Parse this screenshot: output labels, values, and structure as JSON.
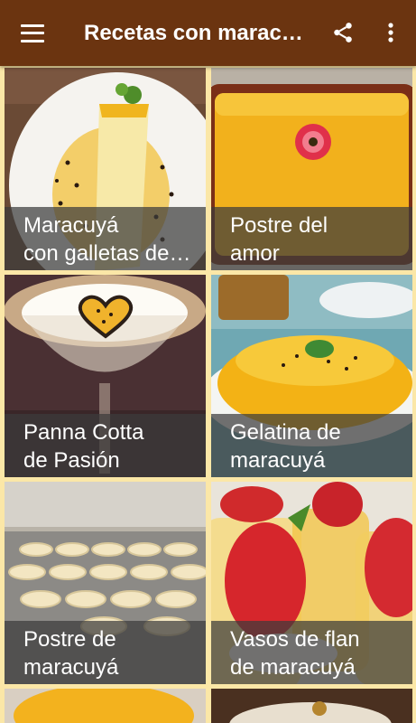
{
  "appbar": {
    "title": "Recetas con maracuyá",
    "icons": [
      "menu-icon",
      "share-icon",
      "more-vert-icon"
    ]
  },
  "colors": {
    "appbar": "#6b3410",
    "background": "#fbe7a7",
    "caption_overlay": "#3c3c3c"
  },
  "recipes": [
    {
      "line1": "Maracuyá",
      "line2": "con galletas de soda"
    },
    {
      "line1": "Postre del",
      "line2": "amor"
    },
    {
      "line1": "Panna Cotta",
      "line2": "de Pasión"
    },
    {
      "line1": "Gelatina de",
      "line2": "maracuyá"
    },
    {
      "line1": "Postre de",
      "line2": "maracuyá"
    },
    {
      "line1": "Vasos de flan",
      "line2": "de maracuyá"
    }
  ]
}
